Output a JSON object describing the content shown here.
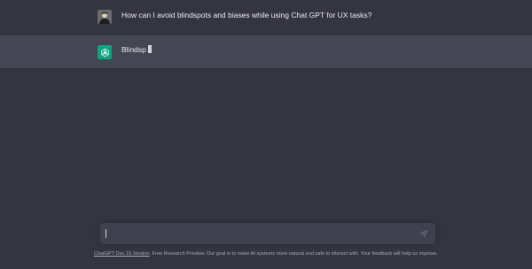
{
  "conversation": {
    "user_message": "How can I avoid blindspots and biases while using Chat GPT for UX tasks?",
    "assistant_message": "Blindsp"
  },
  "icons": {
    "user_avatar": "user-avatar-icon",
    "assistant_avatar": "openai-logo-icon",
    "send": "send-icon"
  },
  "composer": {
    "placeholder": "",
    "value": ""
  },
  "footer": {
    "link_label": "ChatGPT Dec 15 Version",
    "text": ". Free Research Preview. Our goal is to make AI systems more natural and safe to interact with. Your feedback will help us improve."
  },
  "colors": {
    "background": "#343541",
    "assistant_row": "#444654",
    "assistant_avatar": "#10a37f",
    "input_background": "#40414f",
    "text": "#ececf1"
  }
}
